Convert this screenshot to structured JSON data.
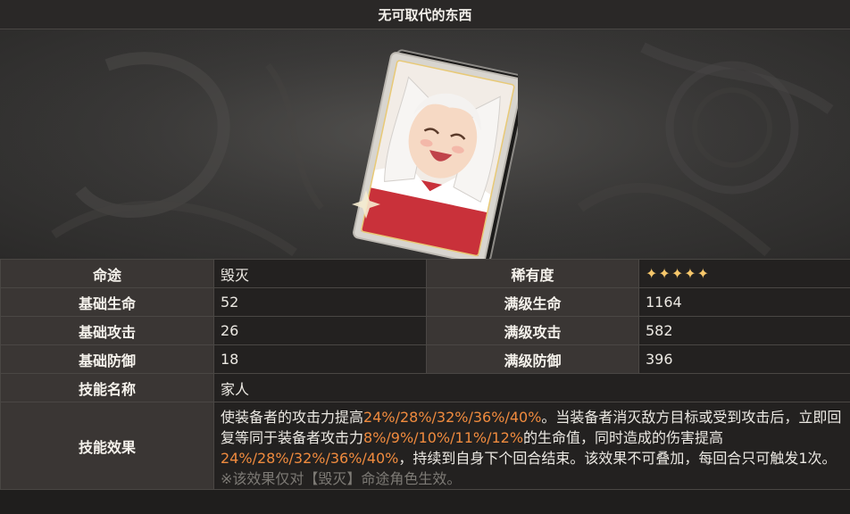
{
  "title": "无可取代的东西",
  "rows": {
    "path": {
      "label": "命途",
      "value": "毁灭"
    },
    "rarity": {
      "label": "稀有度",
      "value": "✦✦✦✦✦"
    },
    "base_hp": {
      "label": "基础生命",
      "value": "52"
    },
    "max_hp": {
      "label": "满级生命",
      "value": "1164"
    },
    "base_atk": {
      "label": "基础攻击",
      "value": "26"
    },
    "max_atk": {
      "label": "满级攻击",
      "value": "582"
    },
    "base_def": {
      "label": "基础防御",
      "value": "18"
    },
    "max_def": {
      "label": "满级防御",
      "value": "396"
    },
    "skill_name": {
      "label": "技能名称",
      "value": "家人"
    },
    "skill_effect": {
      "label": "技能效果",
      "t1": "使装备者的攻击力提高",
      "v1": "24%/28%/32%/36%/40%",
      "t2": "。当装备者消灭敌方目标或受到攻击后，立即回复等同于装备者攻击力",
      "v2": "8%/9%/10%/11%/12%",
      "t3": "的生命值，同时造成的伤害提高",
      "v3": "24%/28%/32%/36%/40%",
      "t4": "，持续到自身下个回合结束。该效果不可叠加，每回合只可触发1次。",
      "note": "※该效果仅对【毁灭】命途角色生效。"
    }
  },
  "colors": {
    "highlight": "#f08b3e",
    "star": "#f6c76b",
    "key_bg": "#3a3634",
    "value_bg": "#232120"
  }
}
